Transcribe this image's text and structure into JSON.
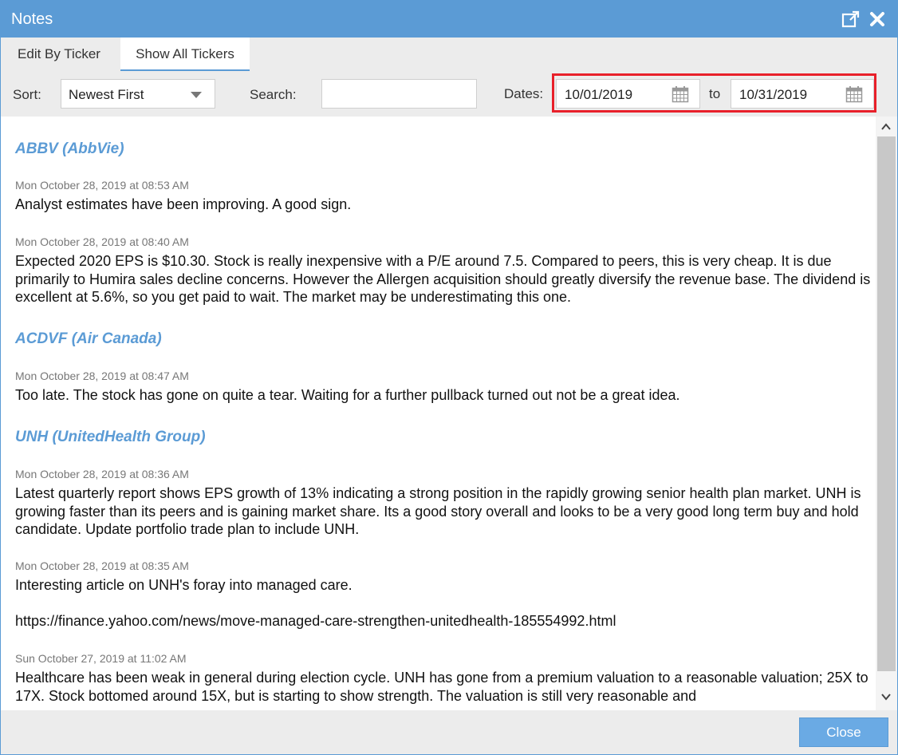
{
  "window": {
    "title": "Notes"
  },
  "tabs": [
    {
      "label": "Edit By Ticker"
    },
    {
      "label": "Show All Tickers"
    }
  ],
  "toolbar": {
    "sort_label": "Sort:",
    "sort_value": "Newest First",
    "search_label": "Search:",
    "search_value": "",
    "search_placeholder": "",
    "dates_label": "Dates:",
    "date_from": "10/01/2019",
    "to_label": "to",
    "date_to": "10/31/2019"
  },
  "groups": [
    {
      "ticker": "ABBV (AbbVie)",
      "notes": [
        {
          "timestamp": "Mon October 28, 2019 at 08:53 AM",
          "text": "Analyst estimates have been improving. A good sign."
        },
        {
          "timestamp": "Mon October 28, 2019 at 08:40 AM",
          "text": "Expected 2020 EPS is $10.30. Stock is really inexpensive with a P/E around 7.5. Compared to peers, this is very cheap. It is due primarily to Humira sales decline concerns. However the Allergen acquisition should greatly diversify the revenue base. The dividend is excellent at 5.6%, so you get paid to wait. The market may be underestimating this one."
        }
      ]
    },
    {
      "ticker": "ACDVF (Air Canada)",
      "notes": [
        {
          "timestamp": "Mon October 28, 2019 at 08:47 AM",
          "text": "Too late. The stock has gone on quite a tear. Waiting for a further pullback turned out not be a great idea."
        }
      ]
    },
    {
      "ticker": "UNH (UnitedHealth Group)",
      "notes": [
        {
          "timestamp": "Mon October 28, 2019 at 08:36 AM",
          "text": "Latest quarterly report shows EPS growth of 13% indicating a strong position in the rapidly growing senior health plan market. UNH is growing faster than its peers and is gaining market share. Its a good story overall and looks to be a very good long term buy and hold candidate. Update portfolio trade plan to include UNH."
        },
        {
          "timestamp": "Mon October 28, 2019 at 08:35 AM",
          "text": "Interesting article on UNH's foray into managed care.",
          "link": "https://finance.yahoo.com/news/move-managed-care-strengthen-unitedhealth-185554992.html"
        },
        {
          "timestamp": "Sun October 27, 2019 at 11:02 AM",
          "text": "Healthcare has been weak in general during election cycle. UNH has gone from a premium valuation to a reasonable valuation; 25X to 17X. Stock bottomed around 15X, but is starting to show strength. The valuation is still very reasonable and"
        }
      ]
    }
  ],
  "footer": {
    "close_label": "Close"
  },
  "icons": {
    "popout": "popout-icon",
    "close": "close-x-icon",
    "calendar": "calendar-icon",
    "dropdown": "chevron-down-icon"
  },
  "colors": {
    "accent": "#5b9bd5",
    "highlight_border": "#e8202a",
    "button": "#6aaae4"
  }
}
